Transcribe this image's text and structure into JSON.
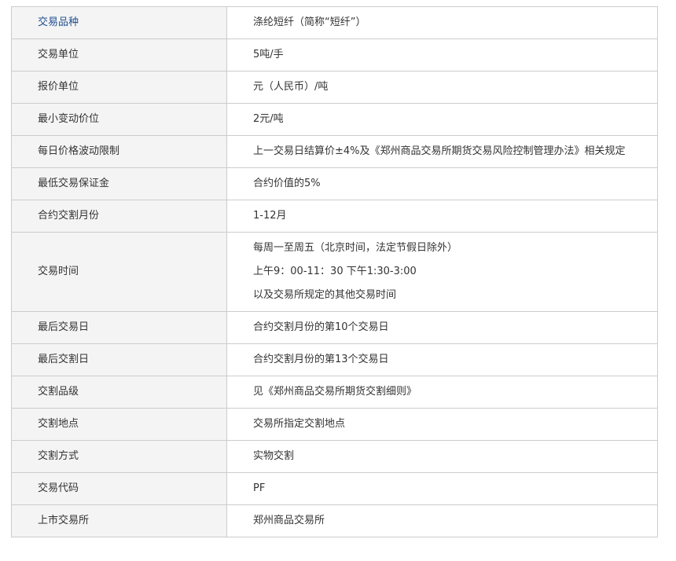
{
  "rows": [
    {
      "label": "交易品种",
      "value": "涤纶短纤（简称“短纤”）"
    },
    {
      "label": "交易单位",
      "value": "5吨/手"
    },
    {
      "label": "报价单位",
      "value": "元（人民币）/吨"
    },
    {
      "label": "最小变动价位",
      "value": "2元/吨"
    },
    {
      "label": "每日价格波动限制",
      "value": "上一交易日结算价±4%及《郑州商品交易所期货交易风险控制管理办法》相关规定"
    },
    {
      "label": "最低交易保证金",
      "value": "合约价值的5%"
    },
    {
      "label": "合约交割月份",
      "value": "1-12月"
    },
    {
      "label": "交易时间",
      "lines": [
        "每周一至周五（北京时间，法定节假日除外）",
        "上午9：00-11：30  下午1:30-3:00",
        "以及交易所规定的其他交易时间"
      ]
    },
    {
      "label": "最后交易日",
      "value": "合约交割月份的第10个交易日"
    },
    {
      "label": "最后交割日",
      "value": "合约交割月份的第13个交易日"
    },
    {
      "label": "交割品级",
      "value": "见《郑州商品交易所期货交割细则》"
    },
    {
      "label": "交割地点",
      "value": "交易所指定交割地点"
    },
    {
      "label": "交割方式",
      "value": "实物交割"
    },
    {
      "label": "交易代码",
      "value": "PF"
    },
    {
      "label": "上市交易所",
      "value": "郑州商品交易所"
    }
  ]
}
